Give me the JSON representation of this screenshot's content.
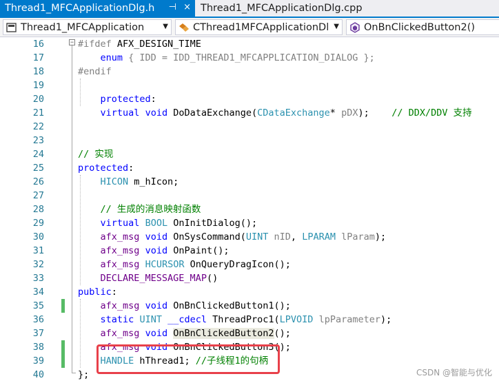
{
  "tabs": [
    {
      "label": "Thread1_MFCApplicationDlg.h",
      "active": true
    },
    {
      "label": "Thread1_MFCApplicationDlg.cpp",
      "active": false
    }
  ],
  "tab_icons": {
    "pin": "pin-icon",
    "close": "close-icon",
    "pin_glyph": "⊣",
    "close_glyph": "×"
  },
  "nav": {
    "project": "Thread1_MFCApplication",
    "class_scope": "CThread1MFCApplicationDl",
    "member": "OnBnClickedButton2()"
  },
  "lines": [
    {
      "n": "16",
      "tokens": [
        [
          "pp",
          "#ifdef "
        ],
        [
          "",
          "AFX_DESIGN_TIME"
        ]
      ]
    },
    {
      "n": "17",
      "tokens": [
        [
          "",
          "    "
        ],
        [
          "kw",
          "enum"
        ],
        [
          "pr",
          " { IDD = IDD_THREAD1_MFCAPPLICATION_DIALOG };"
        ]
      ]
    },
    {
      "n": "18",
      "tokens": [
        [
          "pp",
          "#endif"
        ]
      ]
    },
    {
      "n": "19",
      "tokens": []
    },
    {
      "n": "20",
      "tokens": [
        [
          "",
          "    "
        ],
        [
          "kw",
          "protected"
        ],
        [
          "",
          ":"
        ]
      ]
    },
    {
      "n": "21",
      "tokens": [
        [
          "",
          "    "
        ],
        [
          "kw",
          "virtual"
        ],
        [
          "",
          " "
        ],
        [
          "kw",
          "void"
        ],
        [
          "",
          " DoDataExchange("
        ],
        [
          "ty",
          "CDataExchange"
        ],
        [
          "",
          "* "
        ],
        [
          "pr",
          "pDX"
        ],
        [
          "",
          ");    "
        ],
        [
          "cm",
          "// DDX/DDV 支持"
        ]
      ]
    },
    {
      "n": "22",
      "tokens": []
    },
    {
      "n": "23",
      "tokens": []
    },
    {
      "n": "24",
      "tokens": [
        [
          "cm",
          "// 实现"
        ]
      ]
    },
    {
      "n": "25",
      "tokens": [
        [
          "kw",
          "protected"
        ],
        [
          "",
          ":"
        ]
      ]
    },
    {
      "n": "26",
      "tokens": [
        [
          "",
          "    "
        ],
        [
          "ty",
          "HICON"
        ],
        [
          "",
          " m_hIcon;"
        ]
      ]
    },
    {
      "n": "27",
      "tokens": []
    },
    {
      "n": "28",
      "tokens": [
        [
          "",
          "    "
        ],
        [
          "cm",
          "// 生成的消息映射函数"
        ]
      ]
    },
    {
      "n": "29",
      "tokens": [
        [
          "",
          "    "
        ],
        [
          "kw",
          "virtual"
        ],
        [
          "",
          " "
        ],
        [
          "ty",
          "BOOL"
        ],
        [
          "",
          " OnInitDialog();"
        ]
      ]
    },
    {
      "n": "30",
      "tokens": [
        [
          "",
          "    "
        ],
        [
          "mac",
          "afx_msg"
        ],
        [
          "",
          " "
        ],
        [
          "kw",
          "void"
        ],
        [
          "",
          " OnSysCommand("
        ],
        [
          "ty",
          "UINT"
        ],
        [
          "",
          " "
        ],
        [
          "pr",
          "nID"
        ],
        [
          "",
          ", "
        ],
        [
          "ty",
          "LPARAM"
        ],
        [
          "",
          " "
        ],
        [
          "pr",
          "lParam"
        ],
        [
          "",
          ");"
        ]
      ]
    },
    {
      "n": "31",
      "tokens": [
        [
          "",
          "    "
        ],
        [
          "mac",
          "afx_msg"
        ],
        [
          "",
          " "
        ],
        [
          "kw",
          "void"
        ],
        [
          "",
          " OnPaint();"
        ]
      ]
    },
    {
      "n": "32",
      "tokens": [
        [
          "",
          "    "
        ],
        [
          "mac",
          "afx_msg"
        ],
        [
          "",
          " "
        ],
        [
          "ty",
          "HCURSOR"
        ],
        [
          "",
          " OnQueryDragIcon();"
        ]
      ]
    },
    {
      "n": "33",
      "tokens": [
        [
          "",
          "    "
        ],
        [
          "mac",
          "DECLARE_MESSAGE_MAP"
        ],
        [
          "",
          "()"
        ]
      ]
    },
    {
      "n": "34",
      "tokens": [
        [
          "kw",
          "public"
        ],
        [
          "",
          ":"
        ]
      ]
    },
    {
      "n": "35",
      "changed": true,
      "tokens": [
        [
          "",
          "    "
        ],
        [
          "mac",
          "afx_msg"
        ],
        [
          "",
          " "
        ],
        [
          "kw",
          "void"
        ],
        [
          "",
          " OnBnClickedButton1();"
        ]
      ]
    },
    {
      "n": "36",
      "tokens": [
        [
          "",
          "    "
        ],
        [
          "kw",
          "static"
        ],
        [
          "",
          " "
        ],
        [
          "ty",
          "UINT"
        ],
        [
          "",
          " "
        ],
        [
          "kw",
          "__cdecl"
        ],
        [
          "",
          " ThreadProc1("
        ],
        [
          "ty",
          "LPVOID"
        ],
        [
          "",
          " "
        ],
        [
          "pr",
          "lpParameter"
        ],
        [
          "",
          ");"
        ]
      ]
    },
    {
      "n": "37",
      "tokens": [
        [
          "",
          "    "
        ],
        [
          "mac",
          "afx_msg"
        ],
        [
          "",
          " "
        ],
        [
          "kw",
          "void"
        ],
        [
          "",
          " "
        ],
        [
          "hl",
          "OnBnClickedButton2"
        ],
        [
          "",
          "();"
        ]
      ]
    },
    {
      "n": "38",
      "changed": true,
      "tokens": [
        [
          "",
          "    "
        ],
        [
          "mac",
          "afx_msg"
        ],
        [
          "",
          " "
        ],
        [
          "kw",
          "void"
        ],
        [
          "",
          " OnBnClickedButton3();"
        ]
      ]
    },
    {
      "n": "39",
      "changed": true,
      "tokens": [
        [
          "",
          "    "
        ],
        [
          "ty",
          "HANDLE"
        ],
        [
          "",
          " hThread1; "
        ],
        [
          "cm",
          "//子线程1的句柄"
        ]
      ]
    },
    {
      "n": "40",
      "tokens": [
        [
          "",
          "};"
        ]
      ]
    }
  ],
  "watermark": "CSDN @智能与优化"
}
